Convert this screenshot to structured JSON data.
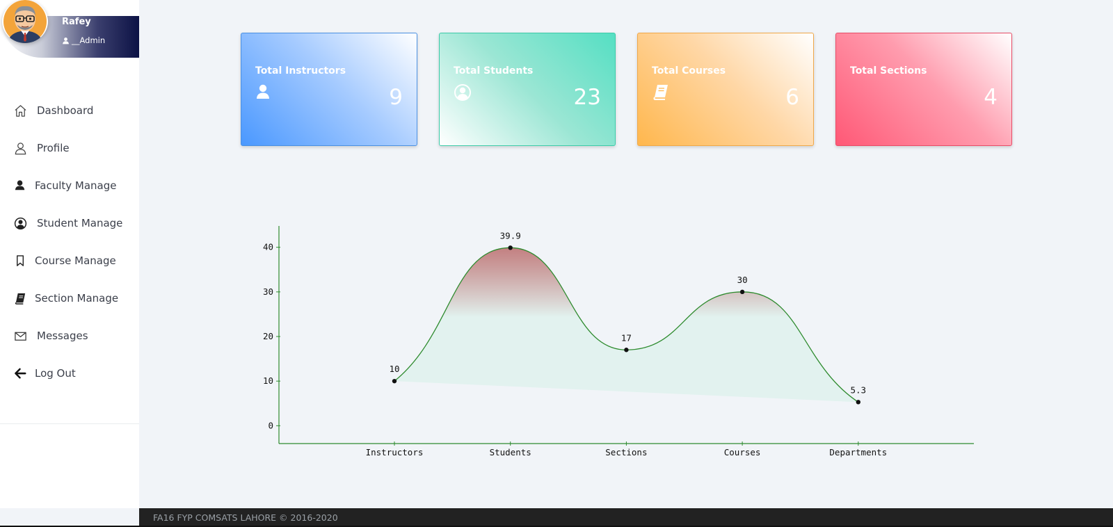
{
  "profile": {
    "name": "Rafey",
    "role": "__Admin",
    "avatar_icon": "avatar-cartoon-man-glasses"
  },
  "sidebar": {
    "items": [
      {
        "label": "Dashboard",
        "icon": "home-icon"
      },
      {
        "label": "Profile",
        "icon": "user-outline-icon"
      },
      {
        "label": "Faculty Manage",
        "icon": "user-solid-icon"
      },
      {
        "label": "Student Manage",
        "icon": "user-circle-icon"
      },
      {
        "label": "Course Manage",
        "icon": "bookmark-icon"
      },
      {
        "label": "Section Manage",
        "icon": "book-icon"
      },
      {
        "label": "Messages",
        "icon": "envelope-icon"
      },
      {
        "label": "Log Out",
        "icon": "arrow-left-icon"
      }
    ]
  },
  "cards": [
    {
      "title": "Total Instructors",
      "value": "9",
      "icon": "user-solid-icon",
      "color": "#4a98ff"
    },
    {
      "title": "Total Students",
      "value": "23",
      "icon": "user-circle-icon",
      "color": "#55dfc3"
    },
    {
      "title": "Total Courses",
      "value": "6",
      "icon": "book-icon",
      "color": "#ffb74d"
    },
    {
      "title": "Total Sections",
      "value": "4",
      "icon": "",
      "color": "#ff5876"
    }
  ],
  "chart_data": {
    "type": "area",
    "categories": [
      "Instructors",
      "Students",
      "Sections",
      "Courses",
      "Departments"
    ],
    "values": [
      10,
      39.9,
      17,
      30,
      5.3
    ],
    "data_labels": [
      "10",
      "39.9",
      "17",
      "30",
      "5.3"
    ],
    "ylim": [
      -4,
      44
    ],
    "yticks": [
      0,
      10,
      20,
      30,
      40
    ],
    "line_color": "#2e8b2e",
    "fill_top_color": "#b45a5a",
    "fill_bottom_color": "#e0f2ee",
    "axis_color": "#2e8b2e",
    "grid": false
  },
  "footer": {
    "text": "FA16 FYP COMSATS LAHORE © 2016-2020"
  }
}
